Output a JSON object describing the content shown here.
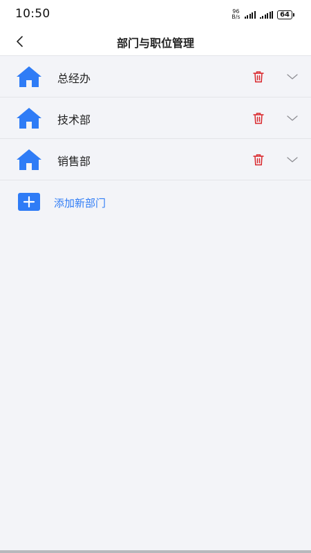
{
  "status_bar": {
    "time": "10:50",
    "net_speed_value": "96",
    "net_speed_unit": "B/s",
    "battery": "64"
  },
  "nav": {
    "title": "部门与职位管理"
  },
  "departments": [
    {
      "name": "总经办"
    },
    {
      "name": "技术部"
    },
    {
      "name": "销售部"
    }
  ],
  "add_department_label": "添加新部门",
  "colors": {
    "accent": "#2f7cf6",
    "delete": "#d9262b",
    "background": "#f3f4f8"
  },
  "icons": {
    "department": "house-icon",
    "delete": "trash-icon",
    "expand": "chevron-down-icon",
    "add": "plus-icon",
    "back": "chevron-left-icon"
  }
}
